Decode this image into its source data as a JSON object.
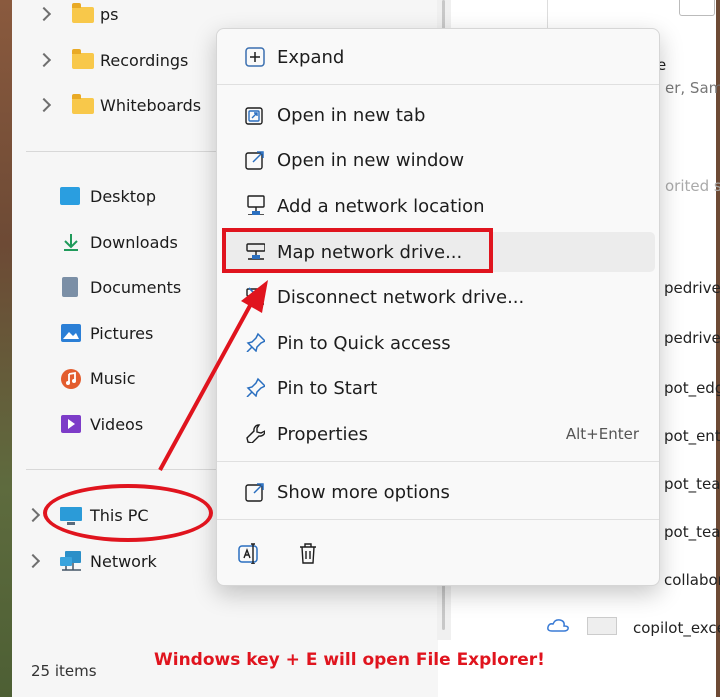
{
  "nav": {
    "folders": [
      {
        "label": "ps"
      },
      {
        "label": "Recordings"
      },
      {
        "label": "Whiteboards"
      }
    ],
    "libraries": [
      {
        "label": "Desktop",
        "icon": "desktop-icon"
      },
      {
        "label": "Downloads",
        "icon": "downloads-icon"
      },
      {
        "label": "Documents",
        "icon": "documents-icon"
      },
      {
        "label": "Pictures",
        "icon": "pictures-icon"
      },
      {
        "label": "Music",
        "icon": "music-icon"
      },
      {
        "label": "Videos",
        "icon": "videos-icon"
      }
    ],
    "this_pc": "This PC",
    "network": "Network"
  },
  "status": {
    "items": "25 items"
  },
  "content": {
    "fragments": [
      "e",
      "er, Sam",
      "orited sc",
      "pedrivesa",
      "pedrivesa",
      "pot_edges",
      "pot_entda",
      "pot_teame",
      "pot_teame",
      "collabora",
      "copilot_excell"
    ]
  },
  "menu": {
    "expand": "Expand",
    "items": [
      {
        "label": "Open in new tab",
        "icon": "new-tab-icon",
        "shortcut": ""
      },
      {
        "label": "Open in new window",
        "icon": "new-window-icon",
        "shortcut": ""
      },
      {
        "label": "Add a network location",
        "icon": "network-location-icon",
        "shortcut": ""
      },
      {
        "label": "Map network drive...",
        "icon": "map-drive-icon",
        "shortcut": ""
      },
      {
        "label": "Disconnect network drive...",
        "icon": "disconnect-drive-icon",
        "shortcut": ""
      },
      {
        "label": "Pin to Quick access",
        "icon": "pin-icon",
        "shortcut": ""
      },
      {
        "label": "Pin to Start",
        "icon": "pin-icon",
        "shortcut": ""
      },
      {
        "label": "Properties",
        "icon": "wrench-icon",
        "shortcut": "Alt+Enter"
      }
    ],
    "show_more": "Show more options"
  },
  "annotation": {
    "caption": "Windows key + E will open File Explorer!",
    "color": "#e0141e"
  },
  "colors": {
    "folder": "#f8c84a",
    "accent": "#1a73c8"
  }
}
